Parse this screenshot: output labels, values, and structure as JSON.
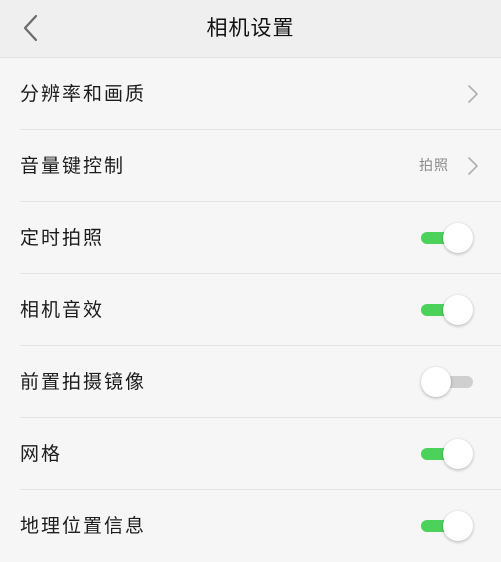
{
  "header": {
    "title": "相机设置",
    "back_icon": "chevron-left-icon"
  },
  "colors": {
    "toggle_on": "#4cd25a",
    "toggle_off": "#cfcfcf",
    "background": "#f6f6f6"
  },
  "settings": [
    {
      "label": "分辨率和画质",
      "type": "link",
      "value": ""
    },
    {
      "label": "音量键控制",
      "type": "link",
      "value": "拍照"
    },
    {
      "label": "定时拍照",
      "type": "toggle",
      "on": true
    },
    {
      "label": "相机音效",
      "type": "toggle",
      "on": true
    },
    {
      "label": "前置拍摄镜像",
      "type": "toggle",
      "on": false
    },
    {
      "label": "网格",
      "type": "toggle",
      "on": true
    },
    {
      "label": "地理位置信息",
      "type": "toggle",
      "on": true
    }
  ]
}
